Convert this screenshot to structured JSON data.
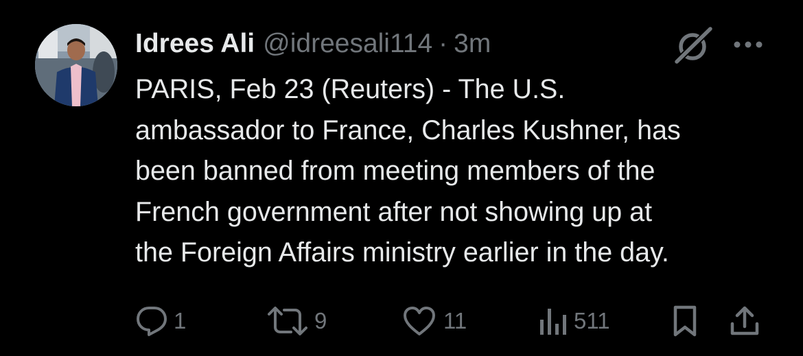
{
  "author": {
    "name": "Idrees Ali",
    "handle": "@idreesali114",
    "separator": "·",
    "timestamp": "3m"
  },
  "tweet": {
    "lines": [
      "PARIS, Feb 23 (Reuters) - The U.S.",
      "ambassador to France, Charles Kushner, has",
      "been banned from meeting members of the",
      "French government after not showing up at",
      "the Foreign Affairs ministry earlier in the day."
    ]
  },
  "actions": {
    "replies": "1",
    "reposts": "9",
    "likes": "11",
    "views": "511"
  },
  "icons": {
    "header": [
      "grok-icon",
      "more-icon"
    ],
    "actions": [
      "reply-icon",
      "repost-icon",
      "like-icon",
      "views-icon",
      "bookmark-icon",
      "share-icon"
    ]
  },
  "colors": {
    "background": "#000000",
    "primary_text": "#e7e9ea",
    "secondary_text": "#71767b"
  }
}
